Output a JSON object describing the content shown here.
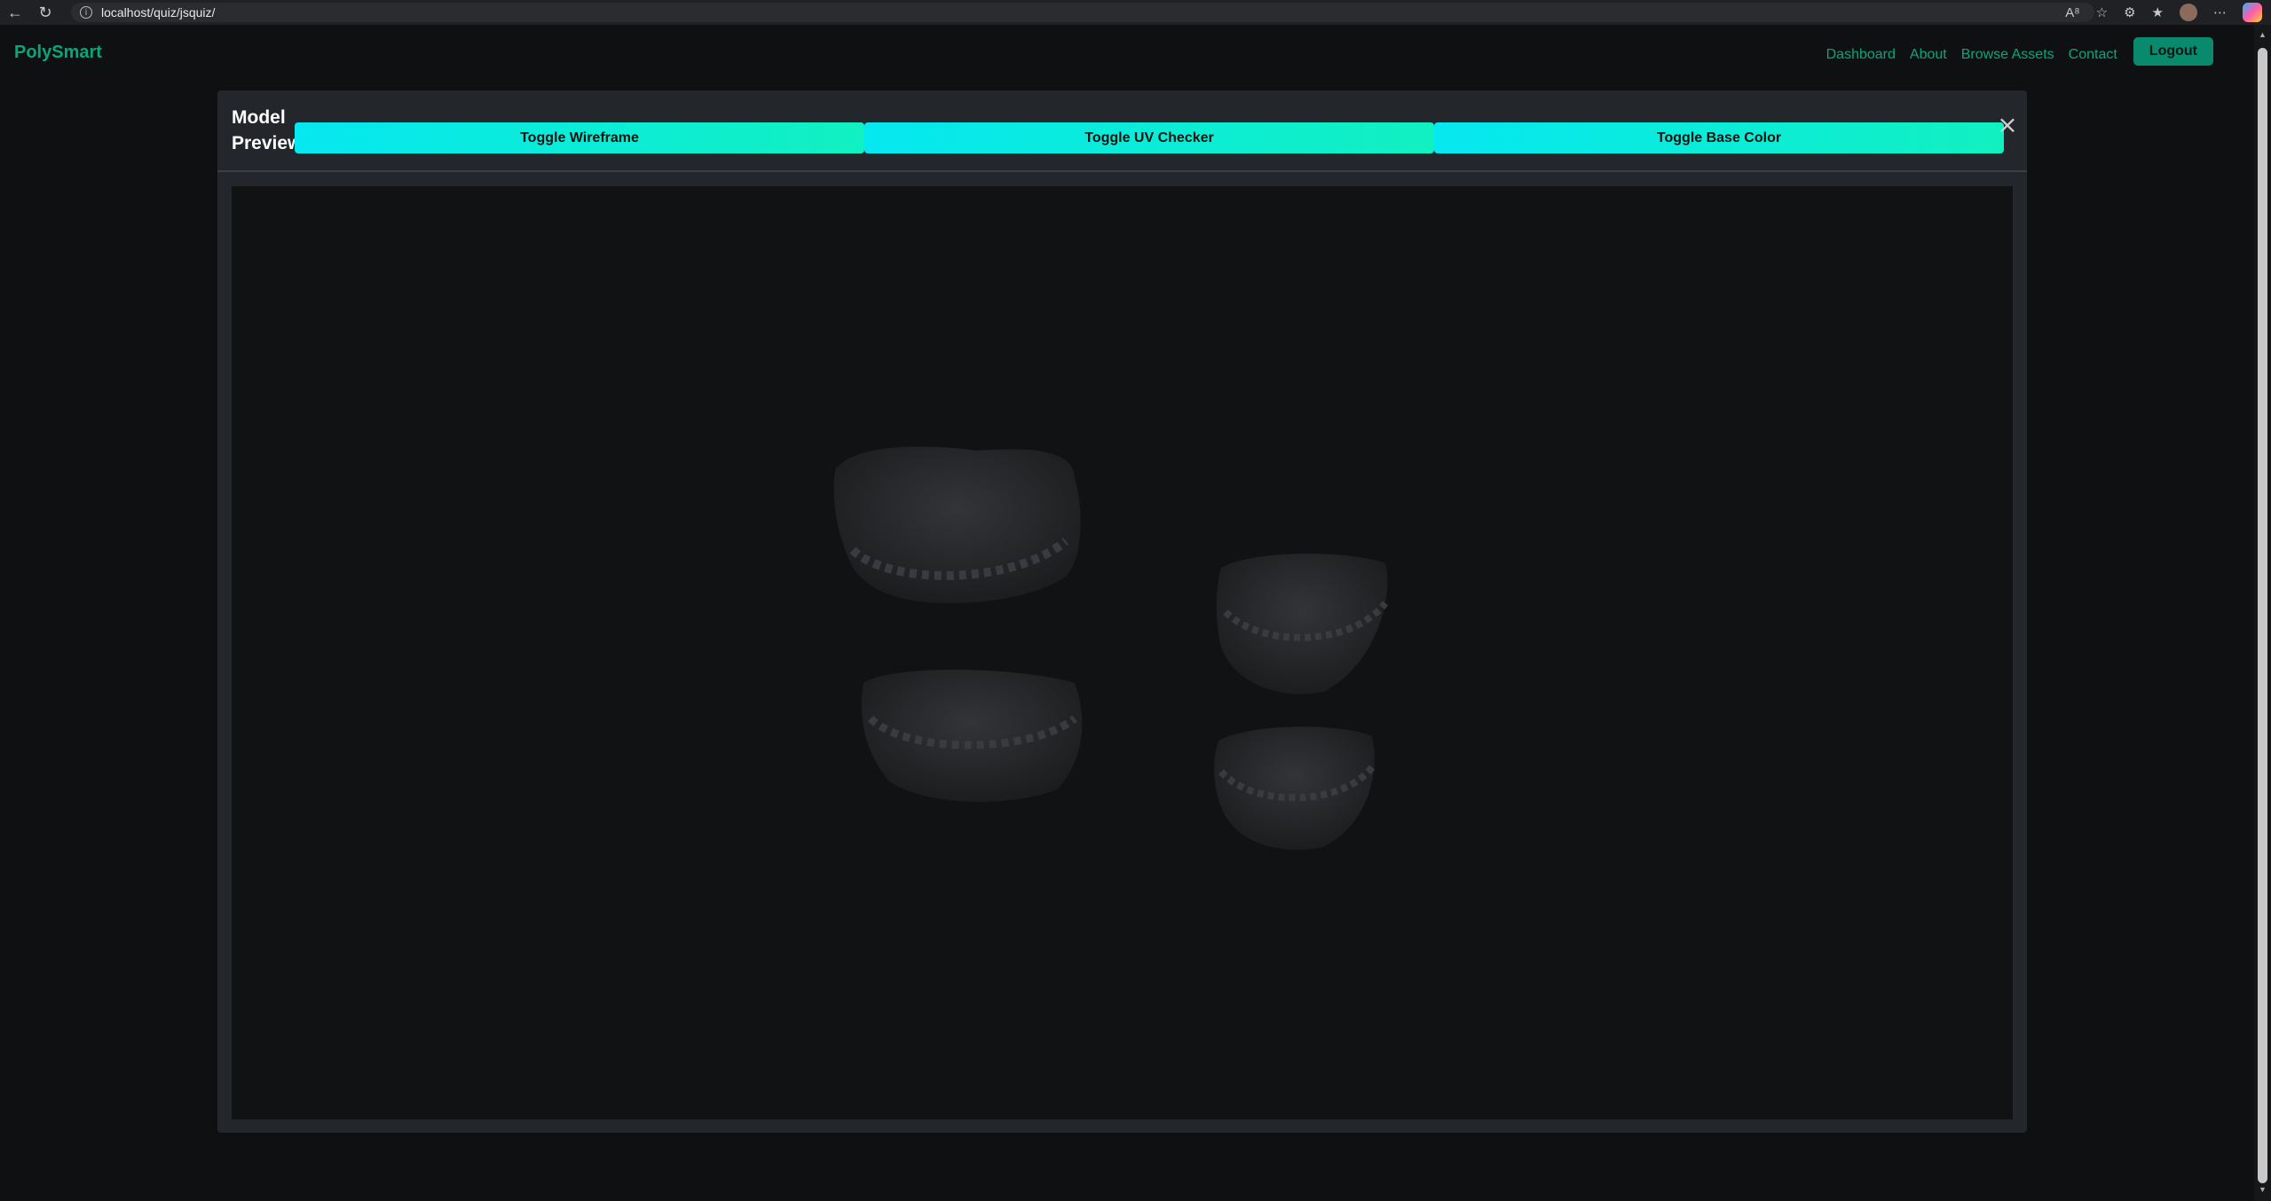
{
  "browser": {
    "url": "localhost/quiz/jsquiz/"
  },
  "navbar": {
    "brand": "PolySmart",
    "links": [
      "Dashboard",
      "About",
      "Browse Assets",
      "Contact"
    ],
    "logout_label": "Logout"
  },
  "modal": {
    "title": "Model Preview",
    "buttons": [
      "Toggle Wireframe",
      "Toggle UV Checker",
      "Toggle Base Color"
    ],
    "close_symbol": "×"
  },
  "viewer": {
    "model_color": "#2a2b2d",
    "background_color": "#111213"
  }
}
